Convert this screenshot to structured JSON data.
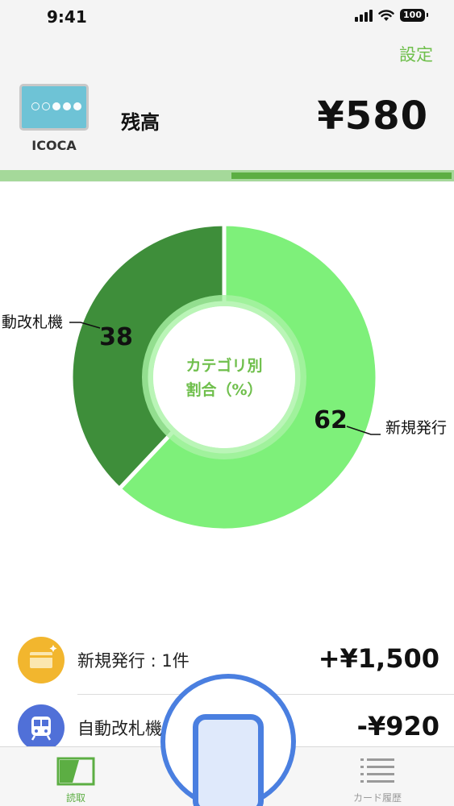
{
  "status_bar": {
    "time": "9:41",
    "battery": "100"
  },
  "header": {
    "settings_label": "設定",
    "card_name": "ICOCA",
    "balance_label": "残高",
    "balance_value": "¥580",
    "progress_fraction": 0.49
  },
  "chart_data": {
    "type": "pie",
    "title": "カテゴリ別\n割合（%）",
    "center_label_lines": [
      "カテゴリ別",
      "割合（%）"
    ],
    "slices": [
      {
        "label": "新規発行",
        "value": 62,
        "color": "#7ef07a"
      },
      {
        "label": "自動改札機",
        "value": 38,
        "color": "#3e8e3a"
      }
    ]
  },
  "transactions": [
    {
      "label": "新規発行 : 1件",
      "amount": "+¥1,500",
      "icon": "card-icon",
      "icon_color": "#f2b62e"
    },
    {
      "label": "自動改札機",
      "amount": "-¥920",
      "icon": "train-icon",
      "icon_color": "#5070d8"
    }
  ],
  "tabbar": {
    "tabs": [
      {
        "label": "読取",
        "icon": "scan-card-icon",
        "active": true
      },
      {
        "label": "カード履歴",
        "icon": "list-icon",
        "active": false
      }
    ],
    "colors": {
      "active": "#5cae43",
      "inactive": "#9a9a9a"
    }
  }
}
